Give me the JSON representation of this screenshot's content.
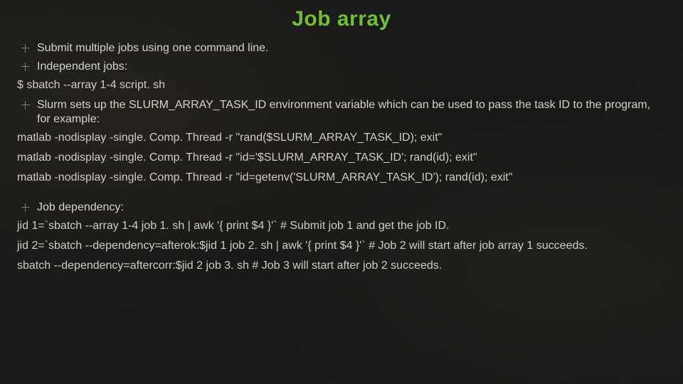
{
  "title": "Job array",
  "bullets": {
    "b1": "Submit multiple jobs using one command line.",
    "b2": "Independent jobs:",
    "b3": "Slurm sets up the SLURM_ARRAY_TASK_ID environment variable which can be used to pass the task ID to the program, for example:",
    "b4": "Job dependency:"
  },
  "code": {
    "c1": "$ sbatch  --array 1-4 script. sh",
    "c2": "matlab -nodisplay -single. Comp. Thread -r \"rand($SLURM_ARRAY_TASK_ID); exit\"",
    "c3": "matlab -nodisplay -single. Comp. Thread -r \"id='$SLURM_ARRAY_TASK_ID'; rand(id); exit\"",
    "c4": "matlab -nodisplay -single. Comp. Thread -r \"id=getenv('SLURM_ARRAY_TASK_ID'); rand(id); exit\"",
    "c5": "jid 1=`sbatch --array 1-4  job 1. sh | awk '{ print $4 }'`            # Submit job 1 and get the job ID.",
    "c6": "jid 2=`sbatch --dependency=afterok:$jid 1  job 2. sh | awk '{ print $4 }'`    # Job 2 will start after job array 1 succeeds.",
    "c7": "sbatch --dependency=aftercorr:$jid 2  job 3. sh            # Job 3 will start after job 2 succeeds."
  }
}
